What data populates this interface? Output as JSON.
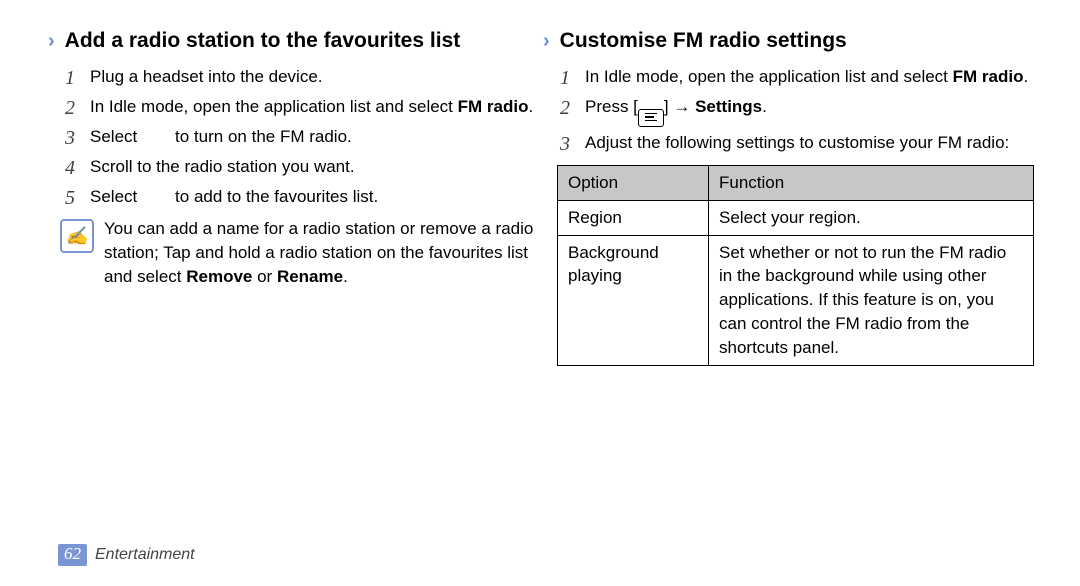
{
  "left": {
    "heading": "Add a radio station to the favourites list",
    "steps": {
      "s1": "Plug a headset into the device.",
      "s2_pre": "In Idle mode, open the application list and select ",
      "s2_bold": "FM radio",
      "s2_post": ".",
      "s3_pre": "Select ",
      "s3_post": " to turn on the FM radio.",
      "s4": "Scroll to the radio station you want.",
      "s5_pre": "Select ",
      "s5_post": " to add to the favourites list."
    },
    "note_pre": "You can add a name for a radio station or remove a radio station; Tap and hold a radio station on the favourites list and select ",
    "note_bold1": "Remove",
    "note_mid": " or ",
    "note_bold2": "Rename",
    "note_post": "."
  },
  "right": {
    "heading": "Customise FM radio settings",
    "steps": {
      "s1_pre": "In Idle mode, open the application list and select ",
      "s1_bold": "FM radio",
      "s1_post": ".",
      "s2_pre": "Press [",
      "s2_mid": "] → ",
      "s2_bold": "Settings",
      "s2_post": ".",
      "s3": "Adjust the following settings to customise your FM radio:"
    },
    "table": {
      "h1": "Option",
      "h2": "Function",
      "r1c1": "Region",
      "r1c2": "Select your region.",
      "r2c1": "Background playing",
      "r2c2": "Set whether or not to run the FM radio in the background while using other applications. If this feature is on, you can control the FM radio from the shortcuts panel."
    }
  },
  "footer": {
    "page": "62",
    "section": "Entertainment"
  }
}
